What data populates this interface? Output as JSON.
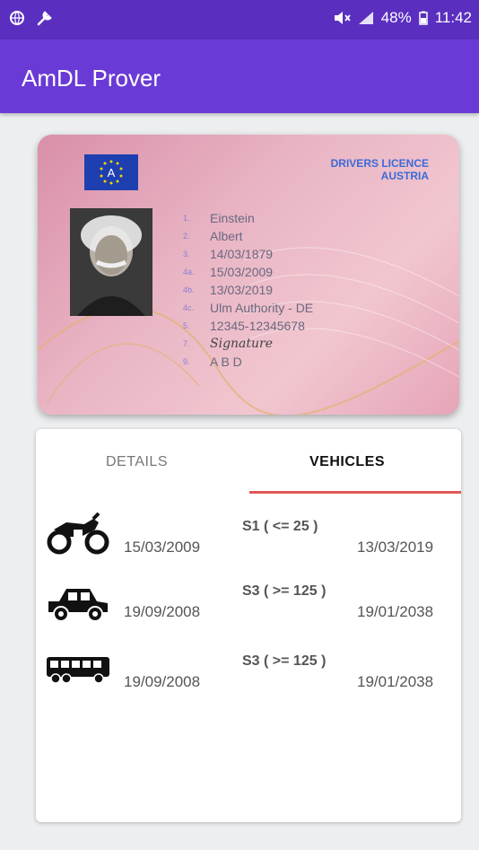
{
  "status_bar": {
    "left_icons": [
      "globe-icon",
      "wrench-icon"
    ],
    "right_icons": [
      "mute-icon",
      "signal-icon",
      "battery-icon"
    ],
    "battery": "48%",
    "time": "11:42"
  },
  "app": {
    "title": "AmDL Prover",
    "brand_color": "#6a3ad6",
    "status_color": "#5a2fc0"
  },
  "license": {
    "title_line1": "DRIVERS LICENCE",
    "title_line2": "AUSTRIA",
    "flag_letter": "A",
    "fields": [
      {
        "num": "1.",
        "value": "Einstein"
      },
      {
        "num": "2.",
        "value": "Albert"
      },
      {
        "num": "3.",
        "value": "14/03/1879"
      },
      {
        "num": "4a.",
        "value": "15/03/2009"
      },
      {
        "num": "4b.",
        "value": "13/03/2019"
      },
      {
        "num": "4c.",
        "value": "Ulm Authority - DE"
      },
      {
        "num": "5.",
        "value": "12345-12345678"
      },
      {
        "num": "7.",
        "value": "Signature"
      },
      {
        "num": "9.",
        "value": "A B D"
      }
    ]
  },
  "tabs": {
    "details": "DETAILS",
    "vehicles": "VEHICLES",
    "active": "VEHICLES",
    "indicator_color": "#e05858"
  },
  "vehicles": [
    {
      "icon": "motorcycle-icon",
      "category": "S1 ( <= 25 )",
      "from": "15/03/2009",
      "to": "13/03/2019"
    },
    {
      "icon": "car-icon",
      "category": "S3 ( >= 125 )",
      "from": "19/09/2008",
      "to": "19/01/2038"
    },
    {
      "icon": "bus-icon",
      "category": "S3 ( >= 125 )",
      "from": "19/09/2008",
      "to": "19/01/2038"
    }
  ]
}
